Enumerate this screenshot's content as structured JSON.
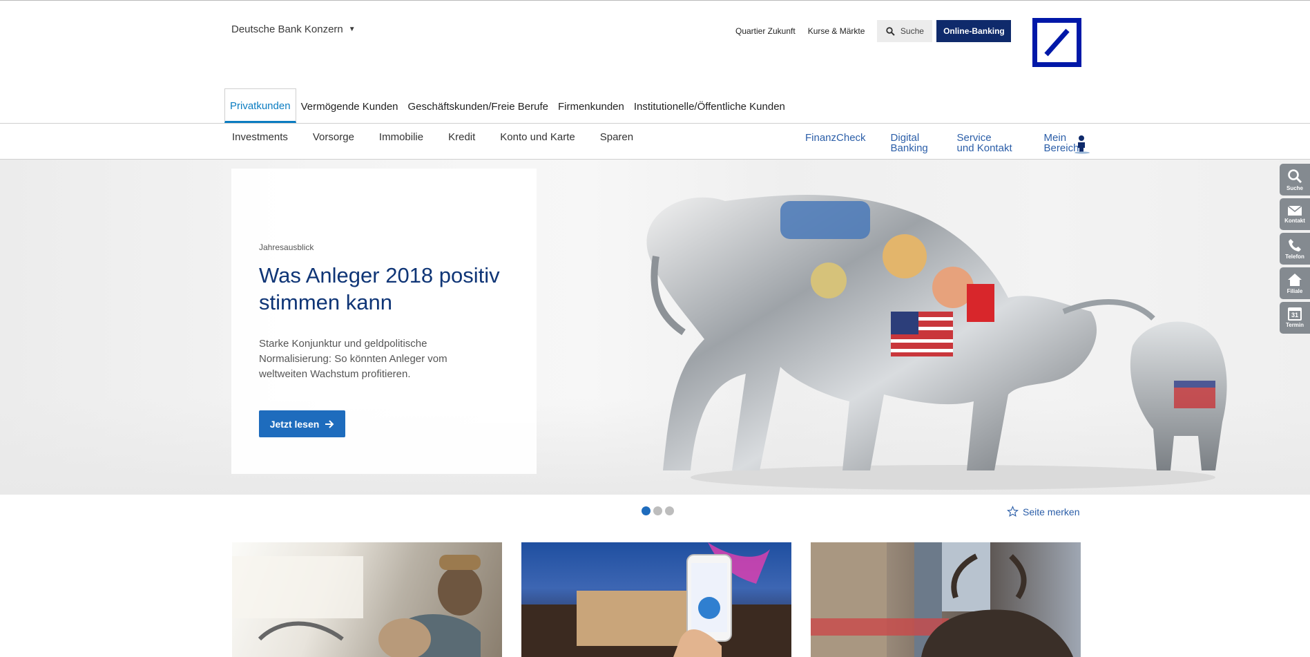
{
  "header": {
    "konzern_label": "Deutsche Bank Konzern",
    "util_links": [
      "Quartier Zukunft",
      "Kurse & Märkte"
    ],
    "search_label": "Suche",
    "online_banking_label": "Online-Banking"
  },
  "segments": [
    {
      "label": "Privatkunden",
      "active": true
    },
    {
      "label": "Vermögende Kunden"
    },
    {
      "label": "Geschäftskunden/Freie Berufe"
    },
    {
      "label": "Firmenkunden"
    },
    {
      "label": "Institutionelle/Öffentliche Kunden"
    }
  ],
  "subnav": [
    "Investments",
    "Vorsorge",
    "Immobilie",
    "Kredit",
    "Konto und Karte",
    "Sparen"
  ],
  "rightnav": [
    {
      "line1": "FinanzCheck",
      "line2": ""
    },
    {
      "line1": "Digital",
      "line2": "Banking"
    },
    {
      "line1": "Service",
      "line2": "und Kontakt"
    },
    {
      "line1": "Mein",
      "line2": "Bereich"
    }
  ],
  "hero": {
    "kicker": "Jahresausblick",
    "headline": "Was Anleger 2018 positiv stimmen kann",
    "teaser": "Starke Konjunktur und geldpolitische Normalisierung: So könnten Anleger vom weltweiten Wachstum profitieren.",
    "cta_label": "Jetzt lesen"
  },
  "carousel": {
    "slides": 3,
    "active_index": 0
  },
  "bookmark_label": "Seite merken",
  "sidebar": [
    {
      "label": "Suche",
      "icon": "search-icon"
    },
    {
      "label": "Kontakt",
      "icon": "mail-icon"
    },
    {
      "label": "Telefon",
      "icon": "phone-icon"
    },
    {
      "label": "Filiale",
      "icon": "home-icon"
    },
    {
      "label": "Termin",
      "icon": "calendar-icon",
      "day": "31"
    }
  ],
  "colors": {
    "brand_blue": "#0018a8",
    "link_blue": "#2b5ea8",
    "accent_blue": "#0a7cc1",
    "online_banking_bg": "#0f2a6b",
    "cta_bg": "#1e6cbd",
    "sidebar_bg": "#848a90"
  }
}
